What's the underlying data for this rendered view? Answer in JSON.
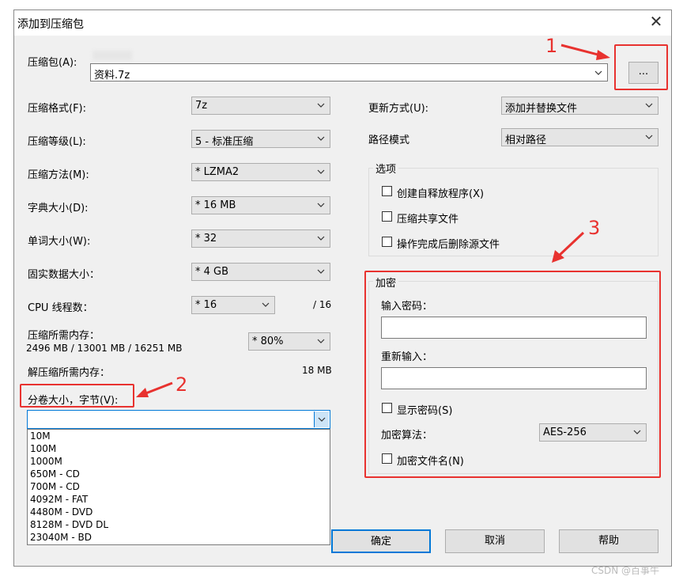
{
  "window": {
    "title": "添加到压缩包",
    "close_glyph": "✕"
  },
  "archive": {
    "label": "压缩包(A):",
    "value": "资料.7z",
    "browse_label": "..."
  },
  "left": {
    "format": {
      "label": "压缩格式(F):",
      "value": "7z"
    },
    "level": {
      "label": "压缩等级(L):",
      "value": "5 - 标准压缩"
    },
    "method": {
      "label": "压缩方法(M):",
      "value": "* LZMA2"
    },
    "dict": {
      "label": "字典大小(D):",
      "value": "* 16 MB"
    },
    "word": {
      "label": "单词大小(W):",
      "value": "* 32"
    },
    "solid": {
      "label": "固实数据大小：",
      "value": "* 4 GB"
    },
    "cpu": {
      "label": "CPU 线程数：",
      "value": "* 16",
      "max": "/ 16"
    },
    "mem": {
      "label": "压缩所需内存：",
      "detail": "2496 MB / 13001 MB / 16251 MB",
      "value": "* 80%"
    },
    "decomp": {
      "label": "解压缩所需内存：",
      "value": "18 MB"
    },
    "split": {
      "label": "分卷大小，字节(V):",
      "value": "",
      "options": [
        "10M",
        "100M",
        "1000M",
        "650M - CD",
        "700M - CD",
        "4092M - FAT",
        "4480M - DVD",
        "8128M - DVD DL",
        "23040M - BD"
      ]
    }
  },
  "right": {
    "update": {
      "label": "更新方式(U):",
      "value": "添加并替换文件"
    },
    "path": {
      "label": "路径模式",
      "value": "相对路径"
    },
    "options": {
      "title": "选项",
      "items": [
        "创建自释放程序(X)",
        "压缩共享文件",
        "操作完成后删除源文件"
      ]
    },
    "encryption": {
      "title": "加密",
      "pwd_label": "输入密码：",
      "repwd_label": "重新输入：",
      "show_label": "显示密码(S)",
      "method_label": "加密算法：",
      "method_value": "AES-256",
      "names_label": "加密文件名(N)"
    }
  },
  "buttons": {
    "ok": "确定",
    "cancel": "取消",
    "help": "帮助"
  },
  "annotations": {
    "n1": "1",
    "n2": "2",
    "n3": "3",
    "color": "#e8322f"
  },
  "watermark": "CSDN @百事牛"
}
